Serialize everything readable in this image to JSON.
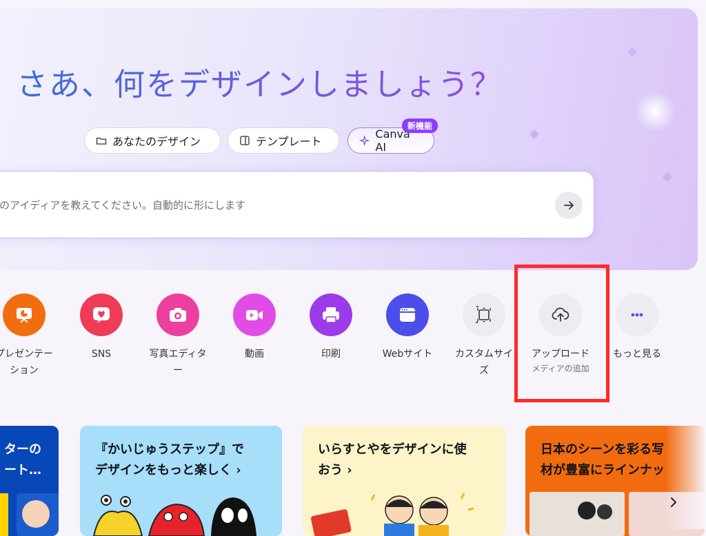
{
  "hero": {
    "title": "さあ、何をデザインしましょう？",
    "pills": [
      {
        "label": "あなたのデザイン",
        "icon": "folder-icon"
      },
      {
        "label": "テンプレート",
        "icon": "template-icon"
      },
      {
        "label": "Canva AI",
        "icon": "sparkle-icon"
      }
    ],
    "badge": "新機能"
  },
  "search": {
    "placeholder": "のアイディアを教えてください。自動的に形にします",
    "submit_icon": "arrow-right-icon"
  },
  "categories": [
    {
      "label": "プレゼンテーション",
      "label_lines": [
        "プレゼンテー",
        "ション"
      ],
      "color": "#f26d0f",
      "icon": "presentation-icon"
    },
    {
      "label": "SNS",
      "color": "#ef3b57",
      "icon": "heart-icon"
    },
    {
      "label": "写真エディター",
      "label_lines": [
        "写真エディタ",
        "ー"
      ],
      "color": "#ec3fa0",
      "icon": "camera-icon"
    },
    {
      "label": "動画",
      "color": "#e24ce6",
      "icon": "video-icon"
    },
    {
      "label": "印刷",
      "color": "#9b3bea",
      "icon": "printer-icon"
    },
    {
      "label": "Webサイト",
      "color": "#4b4ee8",
      "icon": "website-icon"
    },
    {
      "label": "カスタムサイズ",
      "label_lines": [
        "カスタムサイ",
        "ズ"
      ],
      "color": "#ecedf0",
      "icon": "resize-icon"
    },
    {
      "label": "アップロード",
      "sublabel": "メディアの追加",
      "color": "#ecedf0",
      "icon": "cloud-upload-icon"
    },
    {
      "label": "もっと見る",
      "color": "#ecedf0",
      "icon": "more-icon"
    }
  ],
  "cards": [
    {
      "text_lines": [
        "ターの",
        "ート…"
      ],
      "color": "#0747b8",
      "text_color": "#ffffff"
    },
    {
      "text_lines": [
        "『かいじゅうステップ』で",
        "デザインをもっと楽しく ›"
      ],
      "color": "#a7defa",
      "text_color": "#111111"
    },
    {
      "text_lines": [
        "いらすとやをデザインに使",
        "おう ›"
      ],
      "color": "#fdf5c9",
      "text_color": "#111111"
    },
    {
      "text_lines": [
        "日本のシーンを彩る写",
        "材が豊富にラインナッ"
      ],
      "color": "#f26b0f",
      "text_color": "#111111"
    }
  ],
  "carousel_next_icon": "chevron-right-icon"
}
